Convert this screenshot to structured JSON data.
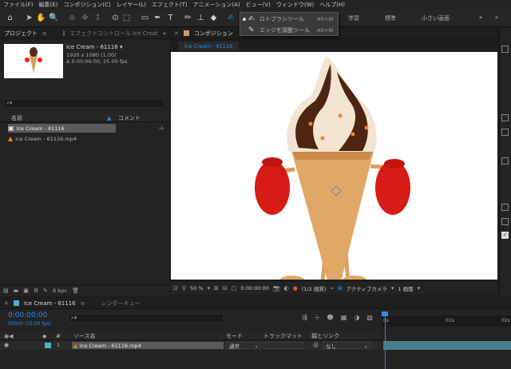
{
  "menu": [
    "ファイル(F)",
    "編集(E)",
    "コンポジション(C)",
    "レイヤー(L)",
    "エフェクト(T)",
    "アニメーション(A)",
    "ビュー(V)",
    "ウィンドウ(W)",
    "ヘルプ(H)"
  ],
  "workspaces": [
    "学習",
    "標準",
    "小さい画面"
  ],
  "dropdown": {
    "items": [
      {
        "label": "ロトブラシツール",
        "shortcut": "Alt+W",
        "selected": true
      },
      {
        "label": "エッジを調整ツール",
        "shortcut": "Alt+W",
        "selected": false
      }
    ]
  },
  "project": {
    "tab": "プロジェクト",
    "effects_tab": "エフェクトコントロール Ice Creat",
    "thumb_name": "Ice Cream - 61116 ▾",
    "thumb_size": "1920 x 1080 (1.00)",
    "thumb_duration": "Δ 0:00:06:00, 25.00 fps",
    "search_icon": "⌕▾",
    "col_name": "名前",
    "col_comment": "コメント",
    "items": [
      "Ice Cream - 61116",
      "Ice Cream - 61116.mp4"
    ],
    "bpc": "8 bpc"
  },
  "comp": {
    "tab": "コンポジション",
    "subtab": "Ice Cream - 61116",
    "zoom": "50 %",
    "timecode": "0:00:00:00",
    "resolution": "(1/2 画質)",
    "camera": "アクティブカメラ",
    "views": "1 画面"
  },
  "timeline": {
    "tab": "Ice Cream - 61116",
    "render_tab": "レンダーキュー",
    "timecode": "0:00:00:00",
    "fps": "00000 (25.00 fps)",
    "cols": {
      "hash": "#",
      "source": "ソース名",
      "mode": "モード",
      "trkmat": "トラックマット",
      "parent": "親とリンク"
    },
    "ruler": [
      "0s",
      "01s",
      "02s"
    ],
    "layer": {
      "num": "1",
      "name": "Ice Cream - 61116.mp4",
      "mode": "通常",
      "parent": "なし"
    }
  },
  "colors": {
    "accent": "#2d8ceb",
    "bg": "#1d1d1d",
    "panel": "#232323",
    "highlight": "#5a5a5a",
    "track": "#4ab3c8"
  }
}
